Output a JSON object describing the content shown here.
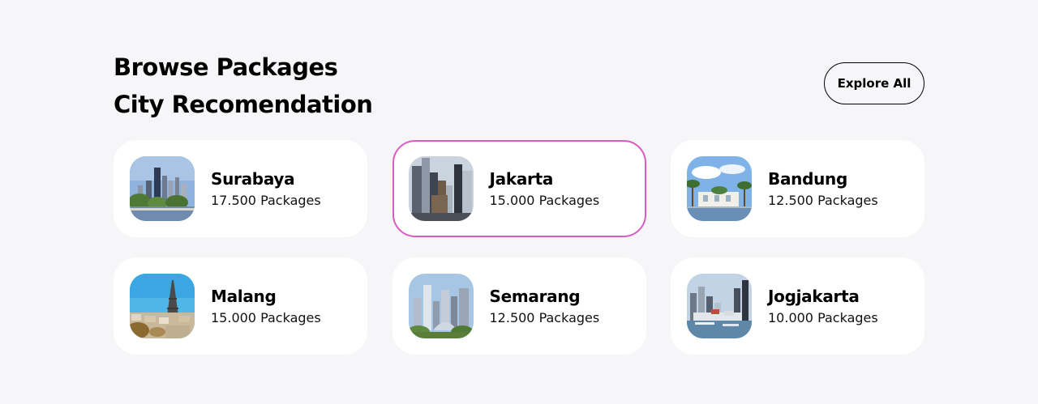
{
  "header": {
    "title_line1": "Browse Packages",
    "title_line2": "City Recomendation",
    "explore_label": "Explore All"
  },
  "cities": [
    {
      "name": "Surabaya",
      "packages": "17.500 Packages",
      "image": "city-skyline-lake-image",
      "active": false
    },
    {
      "name": "Jakarta",
      "packages": "15.000 Packages",
      "image": "city-skyscrapers-image",
      "active": true
    },
    {
      "name": "Bandung",
      "packages": "12.500 Packages",
      "image": "waterfront-palms-image",
      "active": false
    },
    {
      "name": "Malang",
      "packages": "15.000 Packages",
      "image": "eiffel-tower-image",
      "active": false
    },
    {
      "name": "Semarang",
      "packages": "12.500 Packages",
      "image": "modern-towers-image",
      "active": false
    },
    {
      "name": "Jogjakarta",
      "packages": "10.000 Packages",
      "image": "harbor-skyline-image",
      "active": false
    }
  ],
  "colors": {
    "background": "#f6f6f9",
    "card": "#ffffff",
    "active_border": "#d95cbf"
  }
}
